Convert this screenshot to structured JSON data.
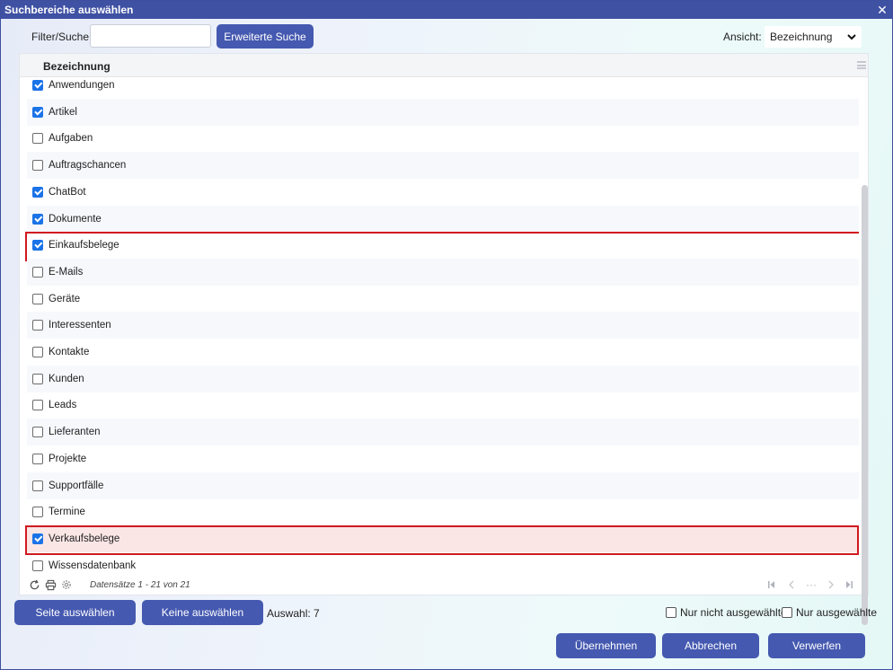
{
  "window": {
    "title": "Suchbereiche auswählen",
    "close_label": "✕"
  },
  "filter": {
    "label": "Filter/Suche:",
    "value": "",
    "placeholder": ""
  },
  "buttons": {
    "advanced_search": "Erweiterte Suche",
    "select_page": "Seite auswählen",
    "select_none": "Keine auswählen",
    "apply": "Übernehmen",
    "cancel": "Abbrechen",
    "discard": "Verwerfen"
  },
  "view": {
    "label": "Ansicht:",
    "selected": "Bezeichnung"
  },
  "grid": {
    "column_header": "Bezeichnung",
    "rows": [
      {
        "label": "Anwendungen",
        "checked": true
      },
      {
        "label": "Artikel",
        "checked": true
      },
      {
        "label": "Aufgaben",
        "checked": false
      },
      {
        "label": "Auftragschancen",
        "checked": false
      },
      {
        "label": "ChatBot",
        "checked": true
      },
      {
        "label": "Dokumente",
        "checked": true
      },
      {
        "label": "Einkaufsbelege",
        "checked": true,
        "highlighted": true
      },
      {
        "label": "E-Mails",
        "checked": false
      },
      {
        "label": "Geräte",
        "checked": false
      },
      {
        "label": "Interessenten",
        "checked": false
      },
      {
        "label": "Kontakte",
        "checked": false
      },
      {
        "label": "Kunden",
        "checked": false
      },
      {
        "label": "Leads",
        "checked": false
      },
      {
        "label": "Lieferanten",
        "checked": false
      },
      {
        "label": "Projekte",
        "checked": false
      },
      {
        "label": "Supportfälle",
        "checked": false
      },
      {
        "label": "Termine",
        "checked": false
      },
      {
        "label": "Verkaufsbelege",
        "checked": true,
        "highlighted": true,
        "selected": true
      },
      {
        "label": "Wissensdatenbank",
        "checked": false
      }
    ],
    "records_text": "Datensätze 1 - 21 von 21",
    "pager_more": "···"
  },
  "selection": {
    "count_text": "Auswahl: 7"
  },
  "options": {
    "only_unselected": {
      "label": "Nur nicht ausgewählte",
      "checked": false
    },
    "only_selected": {
      "label": "Nur ausgewählte",
      "checked": false
    }
  },
  "colors": {
    "accent": "#4559b0",
    "title_bar": "#3f51a3",
    "highlight": "#d0191f",
    "selected_row": "#fbe6e6"
  },
  "icons": [
    "refresh-icon",
    "print-icon",
    "settings-icon",
    "first-page-icon",
    "prev-page-icon",
    "next-page-icon",
    "last-page-icon",
    "column-menu-icon",
    "chevron-down-icon"
  ]
}
